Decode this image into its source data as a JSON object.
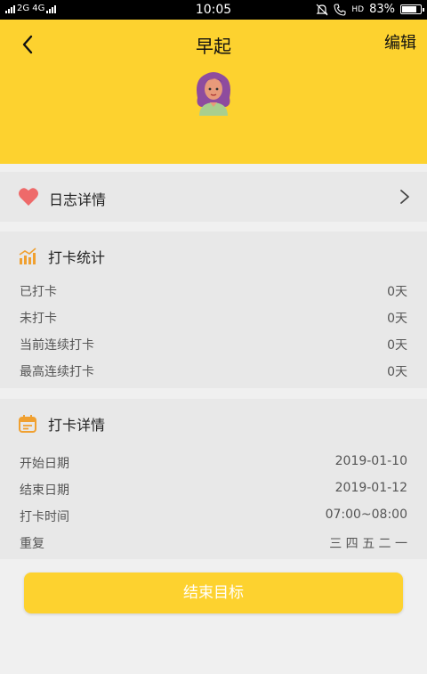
{
  "status_bar": {
    "left_text": "2G 4G",
    "time": "10:05",
    "network": "HD",
    "battery": "83%",
    "battery_level": 0.83
  },
  "header": {
    "title": "早起",
    "edit_label": "编辑"
  },
  "diary": {
    "label": "日志详情"
  },
  "stats": {
    "title": "打卡统计",
    "rows": [
      {
        "label": "已打卡",
        "value": "0天"
      },
      {
        "label": "未打卡",
        "value": "0天"
      },
      {
        "label": "当前连续打卡",
        "value": "0天"
      },
      {
        "label": "最高连续打卡",
        "value": "0天"
      }
    ]
  },
  "details": {
    "title": "打卡详情",
    "rows": [
      {
        "label": "开始日期",
        "value": "2019-01-10"
      },
      {
        "label": "结束日期",
        "value": "2019-01-12"
      },
      {
        "label": "打卡时间",
        "value": "07:00~08:00"
      },
      {
        "label": "重复",
        "value": "三 四 五 二 一"
      }
    ]
  },
  "end_button": {
    "label": "结束目标"
  },
  "colors": {
    "accent": "#fdd22f",
    "heart": "#ee6a6a",
    "icon_orange": "#f0a030"
  }
}
